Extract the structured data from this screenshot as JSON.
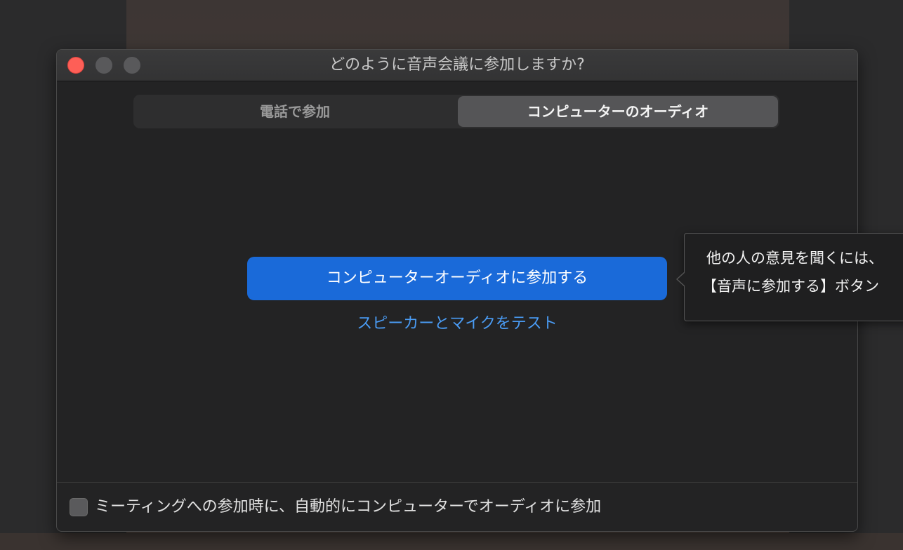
{
  "window": {
    "title": "どのように音声会議に参加しますか?"
  },
  "tabs": [
    {
      "label": "電話で参加",
      "selected": false
    },
    {
      "label": "コンピューターのオーディオ",
      "selected": true
    }
  ],
  "main": {
    "join_button_label": "コンピューターオーディオに参加する",
    "test_link_label": "スピーカーとマイクをテスト"
  },
  "footer": {
    "auto_join_label": "ミーティングへの参加時に、自動的にコンピューターでオーディオに参加",
    "auto_join_checked": false
  },
  "tooltip": {
    "line1": "他の人の意見を聞くには、",
    "line2": "【音声に参加する】ボタン"
  },
  "colors": {
    "accent": "#1a6ad9",
    "link": "#4a9cf5",
    "close": "#fe5f57"
  }
}
